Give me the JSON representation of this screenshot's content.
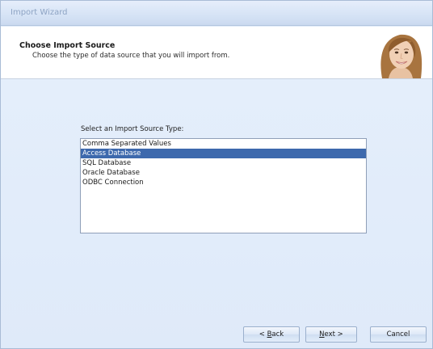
{
  "window": {
    "title": "Import Wizard"
  },
  "header": {
    "title": "Choose Import Source",
    "subtitle": "Choose the type of data source that you will import from."
  },
  "source_list": {
    "label": "Select an Import Source Type:",
    "items": [
      "Comma Separated Values",
      "Access Database",
      "SQL Database",
      "Oracle Database",
      "ODBC Connection"
    ],
    "selected": "Access Database"
  },
  "buttons": {
    "back_prefix": "< ",
    "back_hot": "B",
    "back_rest": "ack",
    "next_hot": "N",
    "next_rest": "ext >",
    "cancel": "Cancel"
  },
  "icons": {
    "avatar": "woman-portrait-icon"
  },
  "colors": {
    "selection": "#3d69ad",
    "panel_background": "#e1ecfa",
    "title_text": "#8ea4c4"
  }
}
